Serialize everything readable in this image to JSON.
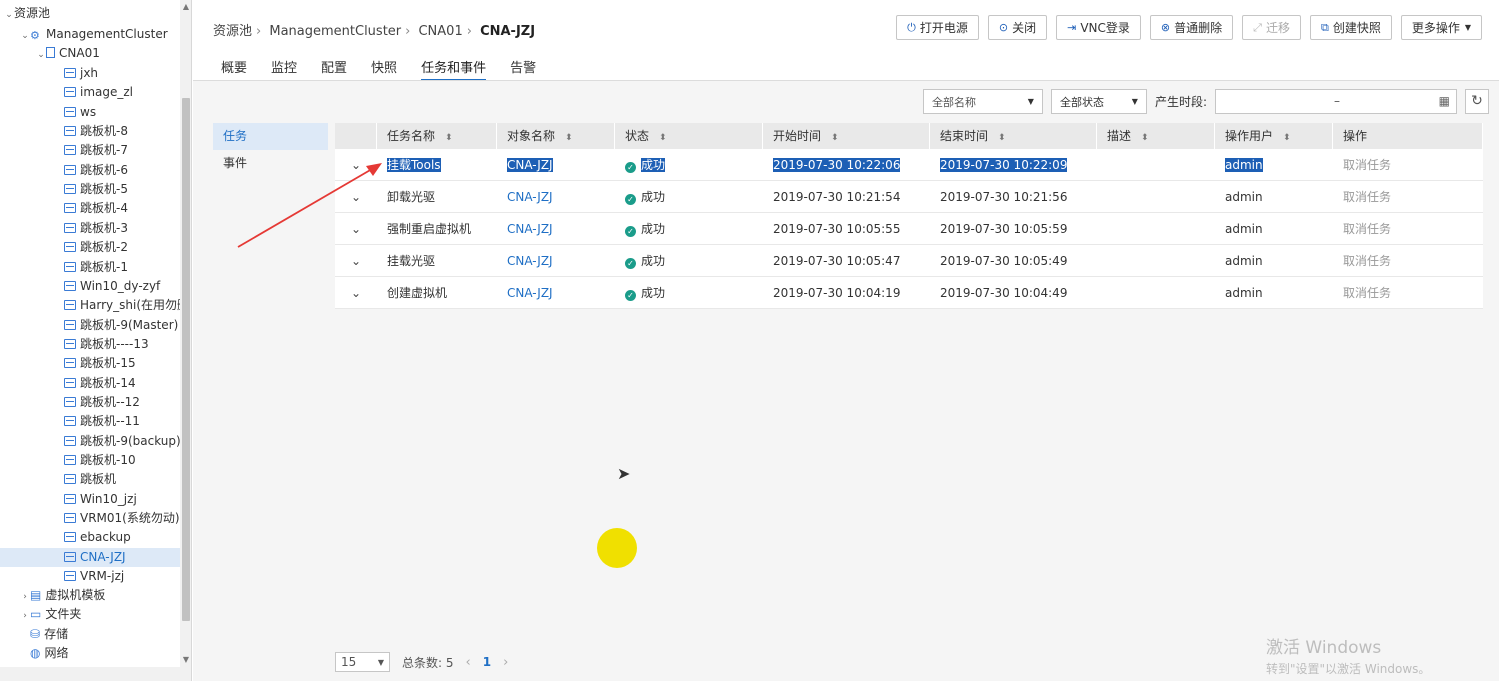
{
  "tree": {
    "root": "资源池",
    "cluster": "ManagementCluster",
    "host": "CNA01",
    "vms": [
      "jxh",
      "image_zl",
      "ws",
      "跳板机-8",
      "跳板机-7",
      "跳板机-6",
      "跳板机-5",
      "跳板机-4",
      "跳板机-3",
      "跳板机-2",
      "跳板机-1",
      "Win10_dy-zyf",
      "Harry_shi(在用勿删",
      "跳板机-9(Master)",
      "跳板机----13",
      "跳板机-15",
      "跳板机-14",
      "跳板机--12",
      "跳板机--11",
      "跳板机-9(backup)",
      "跳板机-10",
      "跳板机",
      "Win10_jzj",
      "VRM01(系统勿动)",
      "ebackup",
      "CNA-JZJ",
      "VRM-jzj"
    ],
    "selected_vm": "CNA-JZJ",
    "groups": [
      "虚拟机模板",
      "文件夹",
      "存储",
      "网络"
    ]
  },
  "breadcrumb": {
    "items": [
      "资源池",
      "ManagementCluster",
      "CNA01"
    ],
    "current": "CNA-JZJ"
  },
  "toolbar": {
    "power_on": "打开电源",
    "shutdown": "关闭",
    "vnc": "VNC登录",
    "delete": "普通删除",
    "migrate": "迁移",
    "snapshot": "创建快照",
    "more": "更多操作"
  },
  "tabs": [
    "概要",
    "监控",
    "配置",
    "快照",
    "任务和事件",
    "告警"
  ],
  "active_tab": "任务和事件",
  "subnav": [
    "任务",
    "事件"
  ],
  "filters": {
    "name": "全部名称",
    "status": "全部状态",
    "period_label": "产生时段:",
    "range_sep": "–"
  },
  "table": {
    "headers": [
      "任务名称",
      "对象名称",
      "状态",
      "开始时间",
      "结束时间",
      "描述",
      "操作用户",
      "操作"
    ],
    "rows": [
      {
        "task": "挂载Tools",
        "object": "CNA-JZJ",
        "status": "成功",
        "start": "2019-07-30 10:22:06",
        "end": "2019-07-30 10:22:09",
        "desc": "",
        "user": "admin",
        "action": "取消任务"
      },
      {
        "task": "卸载光驱",
        "object": "CNA-JZJ",
        "status": "成功",
        "start": "2019-07-30 10:21:54",
        "end": "2019-07-30 10:21:56",
        "desc": "",
        "user": "admin",
        "action": "取消任务"
      },
      {
        "task": "强制重启虚拟机",
        "object": "CNA-JZJ",
        "status": "成功",
        "start": "2019-07-30 10:05:55",
        "end": "2019-07-30 10:05:59",
        "desc": "",
        "user": "admin",
        "action": "取消任务"
      },
      {
        "task": "挂载光驱",
        "object": "CNA-JZJ",
        "status": "成功",
        "start": "2019-07-30 10:05:47",
        "end": "2019-07-30 10:05:49",
        "desc": "",
        "user": "admin",
        "action": "取消任务"
      },
      {
        "task": "创建虚拟机",
        "object": "CNA-JZJ",
        "status": "成功",
        "start": "2019-07-30 10:04:19",
        "end": "2019-07-30 10:04:49",
        "desc": "",
        "user": "admin",
        "action": "取消任务"
      }
    ]
  },
  "pager": {
    "page_size": "15",
    "total": "总条数: 5",
    "current_page": "1"
  },
  "watermark": {
    "line1": "激活 Windows",
    "line2": "转到\"设置\"以激活 Windows。"
  },
  "colors": {
    "accent": "#1f6fc5",
    "success": "#1a9c8a",
    "annotation_arrow": "#e53935",
    "cursor_highlight": "#f0e000"
  }
}
